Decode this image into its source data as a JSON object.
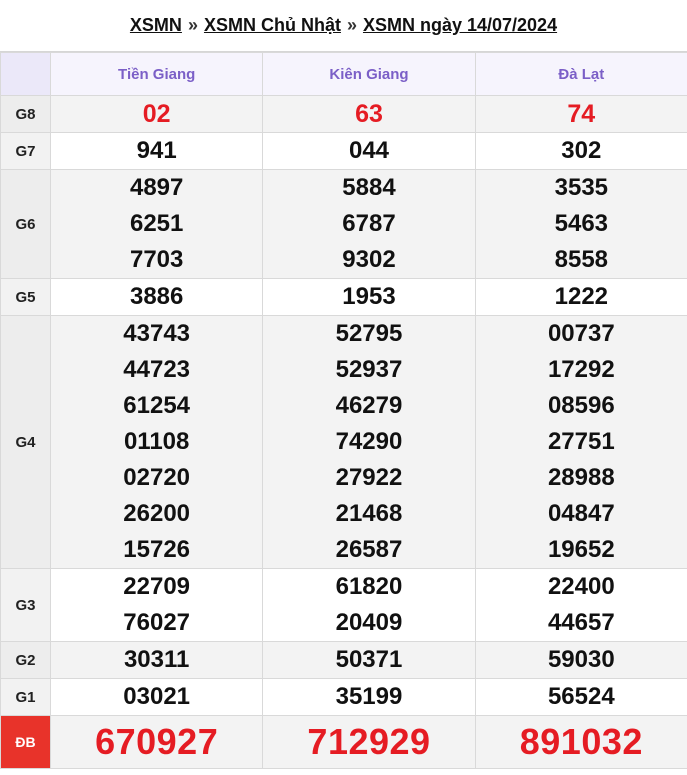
{
  "breadcrumb": {
    "items": [
      "XSMN",
      "XSMN Chủ Nhật",
      "XSMN ngày 14/07/2024"
    ],
    "separator": "»"
  },
  "provinces": [
    "Tiền Giang",
    "Kiên Giang",
    "Đà Lạt"
  ],
  "prizes": [
    {
      "label": "G8",
      "results": [
        [
          "02"
        ],
        [
          "63"
        ],
        [
          "74"
        ]
      ]
    },
    {
      "label": "G7",
      "results": [
        [
          "941"
        ],
        [
          "044"
        ],
        [
          "302"
        ]
      ]
    },
    {
      "label": "G6",
      "results": [
        [
          "4897",
          "6251",
          "7703"
        ],
        [
          "5884",
          "6787",
          "9302"
        ],
        [
          "3535",
          "5463",
          "8558"
        ]
      ]
    },
    {
      "label": "G5",
      "results": [
        [
          "3886"
        ],
        [
          "1953"
        ],
        [
          "1222"
        ]
      ]
    },
    {
      "label": "G4",
      "results": [
        [
          "43743",
          "44723",
          "61254",
          "01108",
          "02720",
          "26200",
          "15726"
        ],
        [
          "52795",
          "52937",
          "46279",
          "74290",
          "27922",
          "21468",
          "26587"
        ],
        [
          "00737",
          "17292",
          "08596",
          "27751",
          "28988",
          "04847",
          "19652"
        ]
      ]
    },
    {
      "label": "G3",
      "results": [
        [
          "22709",
          "76027"
        ],
        [
          "61820",
          "20409"
        ],
        [
          "22400",
          "44657"
        ]
      ]
    },
    {
      "label": "G2",
      "results": [
        [
          "30311"
        ],
        [
          "50371"
        ],
        [
          "59030"
        ]
      ]
    },
    {
      "label": "G1",
      "results": [
        [
          "03021"
        ],
        [
          "35199"
        ],
        [
          "56524"
        ]
      ]
    },
    {
      "label": "ĐB",
      "results": [
        [
          "670927"
        ],
        [
          "712929"
        ],
        [
          "891032"
        ]
      ]
    }
  ],
  "colors": {
    "header_text": "#7b5fc7",
    "highlight_number": "#e51c23",
    "special_label_bg": "#e8332a"
  }
}
